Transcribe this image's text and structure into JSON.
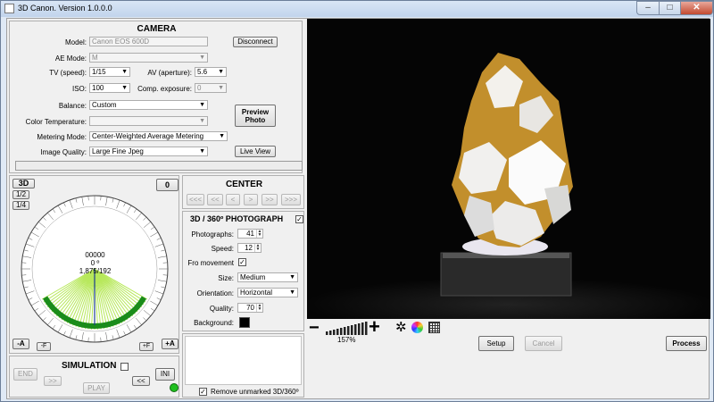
{
  "window": {
    "title": "3D Canon. Version 1.0.0.0",
    "min": "–",
    "max": "□",
    "close": "✕"
  },
  "camera": {
    "header": "CAMERA",
    "model_label": "Model:",
    "model_value": "Canon EOS 600D",
    "disconnect": "Disconnect",
    "ae_mode_label": "AE Mode:",
    "ae_mode_value": "M",
    "tv_label": "TV (speed):",
    "tv_value": "1/15",
    "av_label": "AV (aperture):",
    "av_value": "5.6",
    "iso_label": "ISO:",
    "iso_value": "100",
    "comp_label": "Comp. exposure:",
    "comp_value": "0",
    "balance_label": "Balance:",
    "balance_value": "Custom",
    "color_temp_label": "Color Temperature:",
    "color_temp_value": "",
    "metering_label": "Metering Mode:",
    "metering_value": "Center-Weighted Average Metering",
    "quality_label": "Image Quality:",
    "quality_value": "Large Fine Jpeg",
    "preview_photo": "Preview Photo",
    "live_view": "Live View"
  },
  "turntable": {
    "btn_3d": "3D",
    "btn_half": "1/2",
    "btn_quarter": "1/4",
    "zero": "0",
    "counter": "00000",
    "angle": "0 º",
    "steps": "1,875/192",
    "minus_a": "-A",
    "minus_f": "-F",
    "plus_f": "+F",
    "plus_a": "+A"
  },
  "simulation": {
    "header": "SIMULATION",
    "end": "END",
    "ini": "INI",
    "fwd": ">>",
    "back": "<<",
    "play": "PLAY",
    "status_color": "#1fbf1f"
  },
  "center": {
    "header": "CENTER",
    "b1": "<<<",
    "b2": "<<",
    "b3": "<",
    "b4": ">",
    "b5": ">>",
    "b6": ">>>"
  },
  "photo": {
    "header": "3D / 360º PHOTOGRAPH",
    "photographs_label": "Photographs:",
    "photographs_value": "41",
    "speed_label": "Speed:",
    "speed_value": "12",
    "fro_label": "Fro movement",
    "size_label": "Size:",
    "size_value": "Medium",
    "orientation_label": "Orientation:",
    "orientation_value": "Horizontal",
    "quality_label": "Quality:",
    "quality_value": "70",
    "background_label": "Background:",
    "background_color": "#000000"
  },
  "remove_unmarked": "Remove unmarked 3D/360º",
  "zoom": {
    "minus": "−",
    "plus": "+",
    "percent": "157%"
  },
  "actions": {
    "setup": "Setup",
    "cancel": "Cancel",
    "process": "Process"
  },
  "colors": {
    "accent_green": "#1a8c1a",
    "light_green": "#b7e85a",
    "preview_bg": "#050505"
  }
}
